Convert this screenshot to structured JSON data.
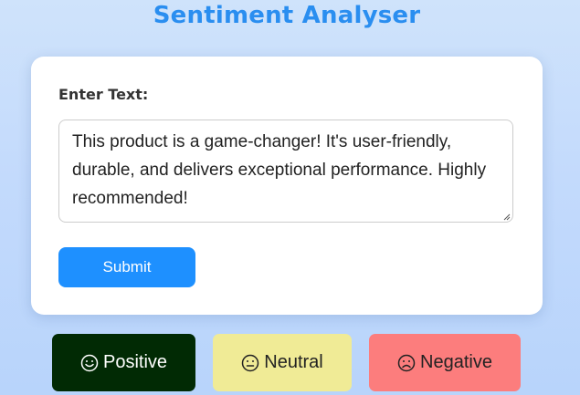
{
  "header": {
    "title": "Sentiment Analyser"
  },
  "form": {
    "label": "Enter Text:",
    "text_value": "This product is a game-changer! It's user-friendly, durable, and delivers exceptional performance. Highly recommended!",
    "submit_label": "Submit"
  },
  "sentiments": [
    {
      "label": "Positive",
      "icon": "smile-icon",
      "color": "#012a04",
      "text_color": "#ffffff",
      "active": true
    },
    {
      "label": "Neutral",
      "icon": "neutral-face-icon",
      "color": "#f0eb96",
      "text_color": "#222222",
      "active": false
    },
    {
      "label": "Negative",
      "icon": "frown-icon",
      "color": "#fc7d7d",
      "text_color": "#222222",
      "active": false
    }
  ],
  "colors": {
    "title": "#2a8ef0",
    "submit": "#1e90ff"
  }
}
